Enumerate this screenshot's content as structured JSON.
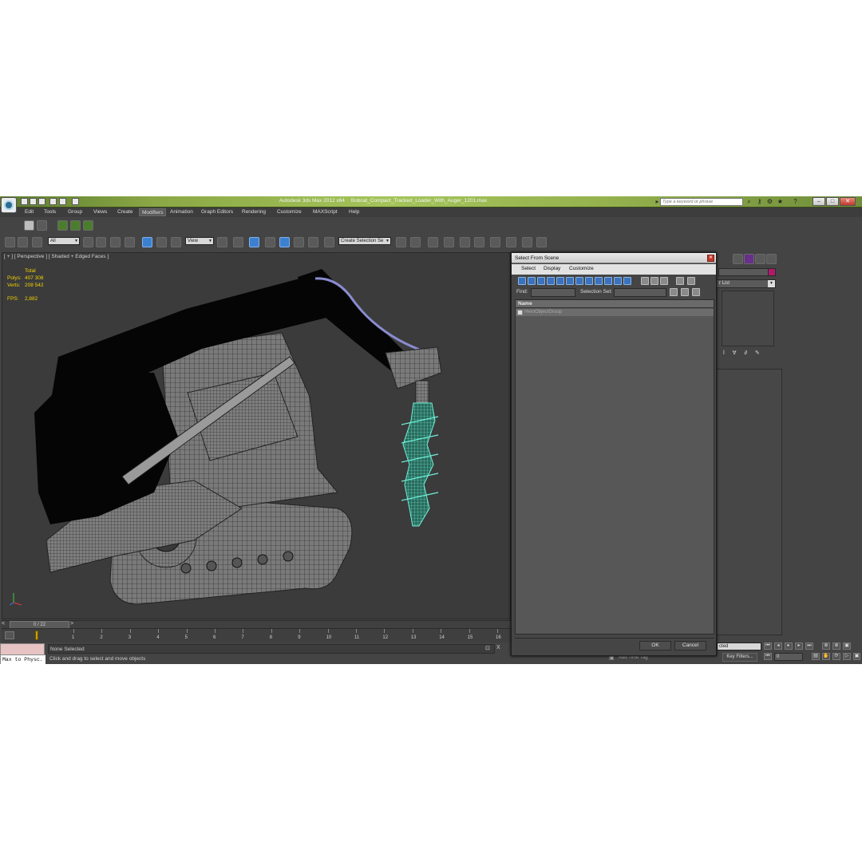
{
  "window": {
    "title_app": "Autodesk 3ds Max 2012 x64",
    "title_file": "Bobcat_Compact_Tracked_Loader_With_Auger_1201.max",
    "search_placeholder": "Type a keyword or phrase",
    "min": "–",
    "max": "□",
    "close": "✕"
  },
  "menu": {
    "items": [
      "Edit",
      "Tools",
      "Group",
      "Views",
      "Create",
      "Modifiers",
      "Animation",
      "Graph Editors",
      "Rendering",
      "Customize",
      "MAXScript",
      "Help"
    ],
    "active_index": 5
  },
  "toolbar": {
    "filter_value": "All",
    "coord_value": "View",
    "selection_set_value": "Create Selection Se"
  },
  "viewport": {
    "label": "[ + ] [ Perspective ] [ Shaded + Edged Faces ]",
    "stats": {
      "header": "Total",
      "polys_label": "Polys:",
      "polys_value": "407 308",
      "verts_label": "Verts:",
      "verts_value": "208 542",
      "fps_label": "FPS:",
      "fps_value": "2,882"
    }
  },
  "command_panel": {
    "list_label": "r List"
  },
  "timeline": {
    "slider_label": "0 / 22",
    "ticks": [
      "1",
      "2",
      "3",
      "4",
      "5",
      "6",
      "7",
      "8",
      "9",
      "10",
      "11",
      "12",
      "13",
      "14",
      "15",
      "16"
    ]
  },
  "status": {
    "maxscript_label": "Max to Physc.",
    "selection_text": "None Selected",
    "prompt_text": "Click and drag to select and move objects",
    "add_time_tag": "Add Time Tag",
    "key_filters": "Key Filters...",
    "selected_dd": "cted",
    "frame_value": "0"
  },
  "dialog": {
    "title": "Select From Scene",
    "menu": [
      "Select",
      "Display",
      "Customize"
    ],
    "find_label": "Find:",
    "selection_set_label": "Selection Set:",
    "column_name": "Name",
    "objects": [
      "HeroObjectGroup"
    ],
    "ok_label": "OK",
    "cancel_label": "Cancel"
  },
  "colors": {
    "titlebar": "#8aa845",
    "background": "#444444",
    "stats_text": "#f2d200",
    "auger_wire": "#5fe3c8",
    "selection_blue": "#3d7fd1"
  }
}
